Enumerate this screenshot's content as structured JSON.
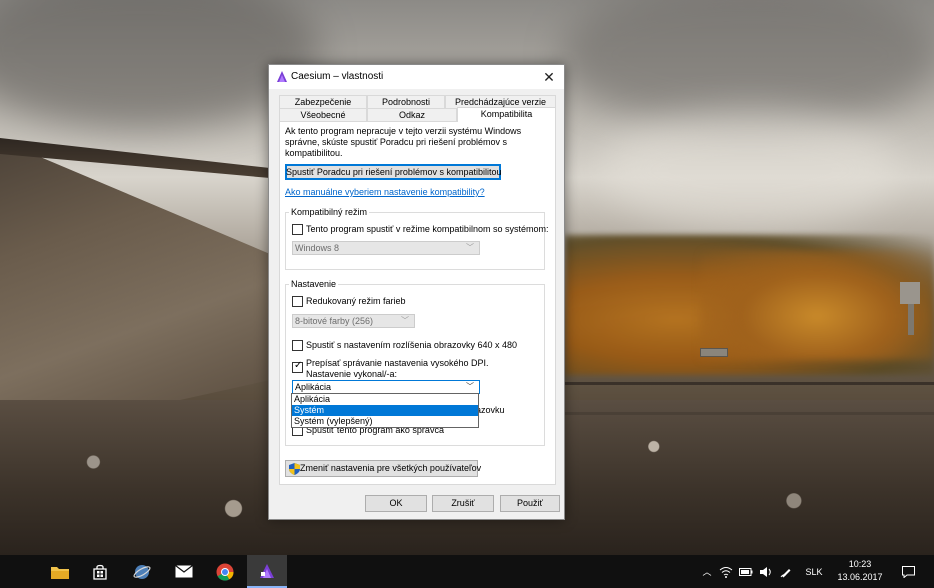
{
  "dialog": {
    "title": "Caesium – vlastnosti",
    "close_glyph": "✕",
    "tabs_row1": [
      "Zabezpečenie",
      "Podrobnosti",
      "Predchádzajúce verzie"
    ],
    "tabs_row2": [
      "Všeobecné",
      "Odkaz",
      "Kompatibilita"
    ],
    "active_tab": "Kompatibilita",
    "intro_text": "Ak tento program nepracuje v tejto verzii systému Windows správne, skúste spustiť Poradcu pri riešení problémov s kompatibilitou.",
    "troubleshooter_button": "Spustiť Poradcu pri riešení problémov s kompatibilitou",
    "manual_link": "Ako manuálne vyberiem nastavenie kompatibility?",
    "compat_group": {
      "label": "Kompatibilný režim",
      "checkbox_label": "Tento program spustiť v režime kompatibilnom so systémom:",
      "checked": false,
      "os_select": "Windows 8"
    },
    "settings_group": {
      "label": "Nastavenie",
      "reduced_color_label": "Redukovaný režim farieb",
      "reduced_color_checked": false,
      "color_select": "8-bitové farby (256)",
      "res_label": "Spustiť s nastavením rozlíšenia obrazovky 640 x 480",
      "res_checked": false,
      "dpi_label_line1": "Prepísať správanie nastavenia vysokého DPI.",
      "dpi_label_line2": "Nastavenie vykonal/-a:",
      "dpi_checked": true,
      "dpi_select": "Aplikácia",
      "dropdown_options": [
        "Aplikácia",
        "Systém",
        "Systém (vylepšený)"
      ],
      "dropdown_selected": "Systém",
      "hidden_fragment": "azovku",
      "admin_label": "Spustiť tento program ako správca",
      "admin_checked": false
    },
    "all_users_button": "Zmeniť nastavenia pre všetkých používateľov",
    "ok_button": "OK",
    "cancel_button": "Zrušiť",
    "apply_button": "Použiť"
  },
  "taskbar": {
    "tray": {
      "language": "SLK",
      "time": "10:23",
      "date": "13.06.2017"
    }
  }
}
